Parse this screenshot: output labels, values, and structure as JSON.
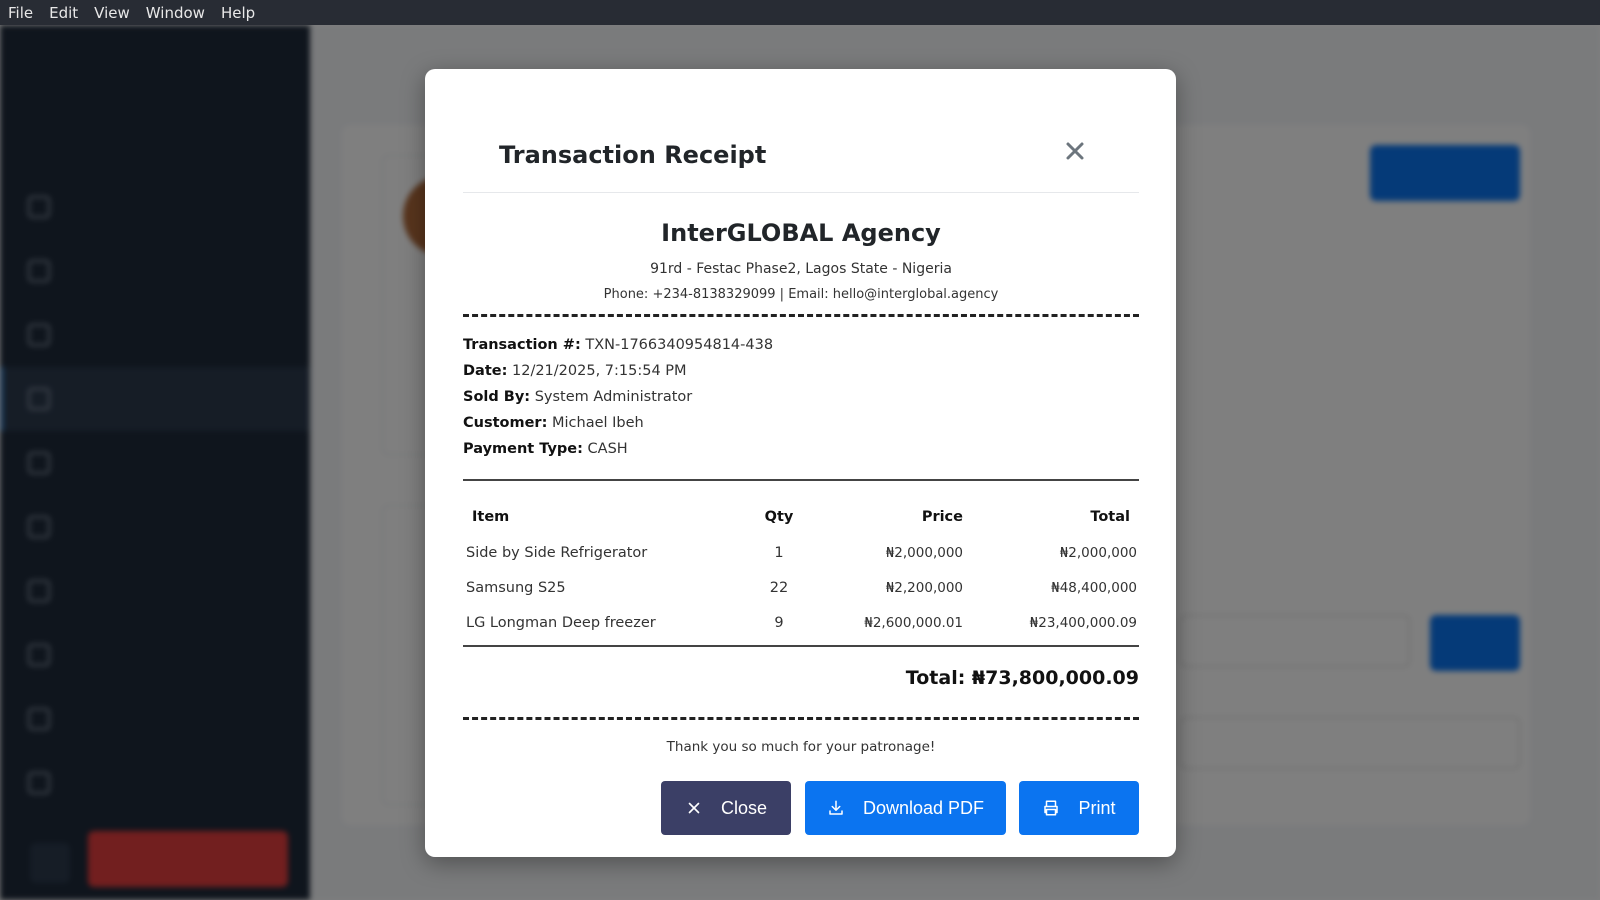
{
  "menubar": {
    "items": [
      "File",
      "Edit",
      "View",
      "Window",
      "Help"
    ]
  },
  "modal": {
    "title": "Transaction Receipt",
    "close_icon": "close-icon",
    "company": {
      "name": "InterGLOBAL Agency",
      "address": "91rd - Festac Phase2, Lagos State - Nigeria",
      "contact": "Phone: +234-8138329099 | Email: hello@interglobal.agency"
    },
    "info": [
      {
        "label": "Transaction #:",
        "value": "TXN-1766340954814-438"
      },
      {
        "label": "Date:",
        "value": "12/21/2025, 7:15:54 PM"
      },
      {
        "label": "Sold By:",
        "value": "System Administrator"
      },
      {
        "label": "Customer:",
        "value": "Michael Ibeh"
      },
      {
        "label": "Payment Type:",
        "value": "CASH"
      }
    ],
    "table": {
      "headers": {
        "item": "Item",
        "qty": "Qty",
        "price": "Price",
        "total": "Total"
      },
      "rows": [
        {
          "item": "Side by Side Refrigerator",
          "qty": "1",
          "price": "₦2,000,000",
          "total": "₦2,000,000"
        },
        {
          "item": "Samsung S25",
          "qty": "22",
          "price": "₦2,200,000",
          "total": "₦48,400,000"
        },
        {
          "item": "LG Longman Deep freezer",
          "qty": "9",
          "price": "₦2,600,000.01",
          "total": "₦23,400,000.09"
        }
      ]
    },
    "grand_total": "Total: ₦73,800,000.09",
    "thanks": "Thank you so much for your patronage!",
    "buttons": {
      "close": "Close",
      "download": "Download PDF",
      "print": "Print"
    }
  },
  "colors": {
    "primary": "#0b74f0",
    "close_button": "#3b3f66",
    "sidebar": "#1e2a3a",
    "menubar": "#282c34"
  }
}
